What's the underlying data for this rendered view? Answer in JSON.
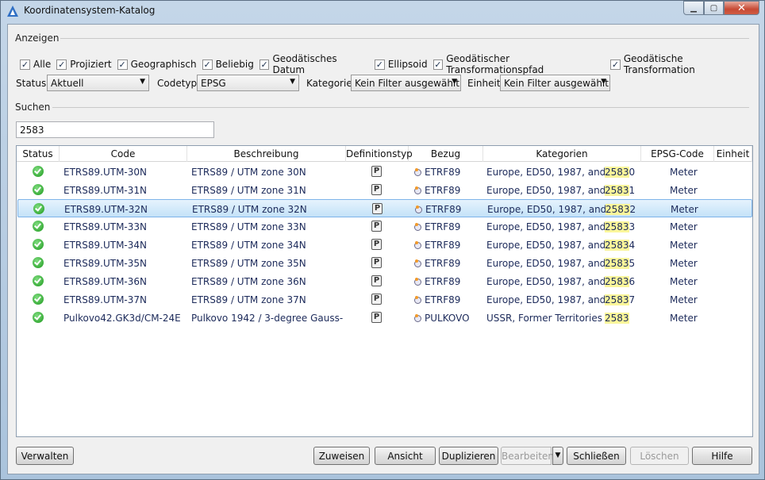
{
  "window": {
    "title": "Koordinatensystem-Katalog",
    "icon": "app-triangle-icon",
    "controls": {
      "minimize": "minimize-icon",
      "maximize": "maximize-icon",
      "close": "close-icon"
    }
  },
  "display": {
    "group_label": "Anzeigen",
    "checkboxes": [
      {
        "label": "Alle",
        "checked": true
      },
      {
        "label": "Projiziert",
        "checked": true
      },
      {
        "label": "Geographisch",
        "checked": true
      },
      {
        "label": "Beliebig",
        "checked": true
      },
      {
        "label": "Geodätisches Datum",
        "checked": true
      },
      {
        "label": "Ellipsoid",
        "checked": true
      },
      {
        "label": "Geodätischer Transformationspfad",
        "checked": true
      },
      {
        "label": "Geodätische Transformation",
        "checked": true
      }
    ]
  },
  "filters": {
    "status_label": "Status:",
    "status_value": "Aktuell",
    "codetyp_label": "Codetyp:",
    "codetyp_value": "EPSG",
    "kategorie_label": "Kategorie:",
    "kategorie_value": "Kein Filter ausgewählt",
    "einheit_label": "Einheit:",
    "einheit_value": "Kein Filter ausgewählt"
  },
  "search": {
    "group_label": "Suchen",
    "value": "2583"
  },
  "table": {
    "columns": [
      "Status",
      "Code",
      "Beschreibung",
      "Definitionstyp",
      "Bezug",
      "Kategorien",
      "EPSG-Code",
      "Einheit"
    ],
    "selected_index": 2,
    "rows": [
      {
        "code": "ETRS89.UTM-30N",
        "desc": "ETRS89 / UTM zone 30N",
        "type": "P",
        "ref": "ETRF89",
        "cat": "Europe, ED50, 1987, and...",
        "epsg_match": "2583",
        "epsg_rest": "0",
        "unit": "Meter"
      },
      {
        "code": "ETRS89.UTM-31N",
        "desc": "ETRS89 / UTM zone 31N",
        "type": "P",
        "ref": "ETRF89",
        "cat": "Europe, ED50, 1987, and...",
        "epsg_match": "2583",
        "epsg_rest": "1",
        "unit": "Meter"
      },
      {
        "code": "ETRS89.UTM-32N",
        "desc": "ETRS89 / UTM zone 32N",
        "type": "P",
        "ref": "ETRF89",
        "cat": "Europe, ED50, 1987, and...",
        "epsg_match": "2583",
        "epsg_rest": "2",
        "unit": "Meter"
      },
      {
        "code": "ETRS89.UTM-33N",
        "desc": "ETRS89 / UTM zone 33N",
        "type": "P",
        "ref": "ETRF89",
        "cat": "Europe, ED50, 1987, and...",
        "epsg_match": "2583",
        "epsg_rest": "3",
        "unit": "Meter"
      },
      {
        "code": "ETRS89.UTM-34N",
        "desc": "ETRS89 / UTM zone 34N",
        "type": "P",
        "ref": "ETRF89",
        "cat": "Europe, ED50, 1987, and...",
        "epsg_match": "2583",
        "epsg_rest": "4",
        "unit": "Meter"
      },
      {
        "code": "ETRS89.UTM-35N",
        "desc": "ETRS89 / UTM zone 35N",
        "type": "P",
        "ref": "ETRF89",
        "cat": "Europe, ED50, 1987, and...",
        "epsg_match": "2583",
        "epsg_rest": "5",
        "unit": "Meter"
      },
      {
        "code": "ETRS89.UTM-36N",
        "desc": "ETRS89 / UTM zone 36N",
        "type": "P",
        "ref": "ETRF89",
        "cat": "Europe, ED50, 1987, and...",
        "epsg_match": "2583",
        "epsg_rest": "6",
        "unit": "Meter"
      },
      {
        "code": "ETRS89.UTM-37N",
        "desc": "ETRS89 / UTM zone 37N",
        "type": "P",
        "ref": "ETRF89",
        "cat": "Europe, ED50, 1987, and...",
        "epsg_match": "2583",
        "epsg_rest": "7",
        "unit": "Meter"
      },
      {
        "code": "Pulkovo42.GK3d/CM-24E",
        "desc": "Pulkovo 1942 / 3-degree Gauss-K...",
        "type": "P",
        "ref": "PULKOVO",
        "cat": "USSR, Former Territories",
        "epsg_match": "2583",
        "epsg_rest": "",
        "unit": "Meter"
      }
    ]
  },
  "buttons": {
    "verwalten": "Verwalten",
    "zuweisen": "Zuweisen",
    "ansicht": "Ansicht",
    "duplizieren": "Duplizieren",
    "bearbeiten": "Bearbeiten",
    "schliessen": "Schließen",
    "loeschen": "Löschen",
    "hilfe": "Hilfe"
  },
  "colors": {
    "selection": "#c4e2f8",
    "match_highlight": "#fbf69a",
    "status_ok": "#1e9a1e"
  }
}
